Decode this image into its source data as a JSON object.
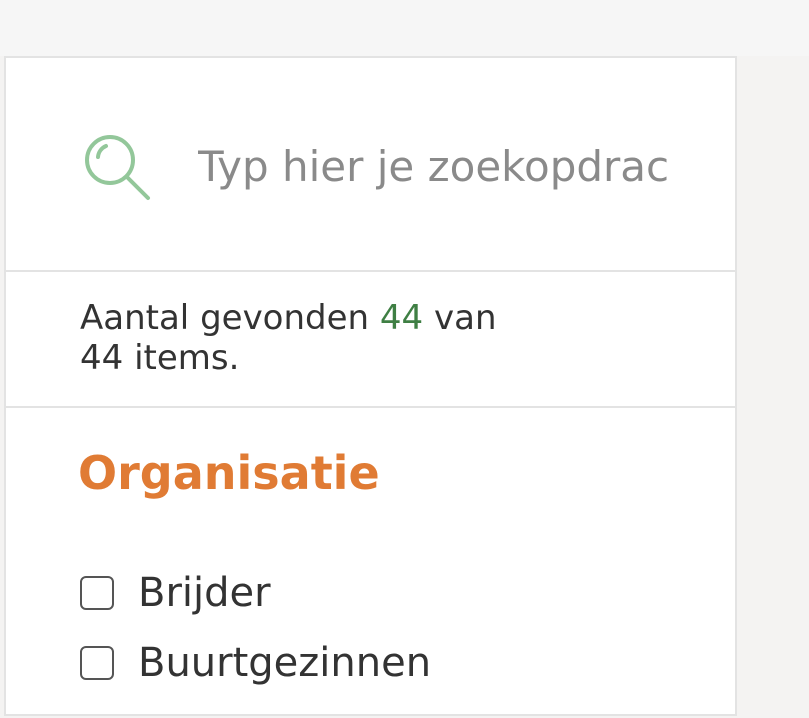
{
  "search": {
    "placeholder": "Typ hier je zoekopdracht",
    "icon": "search-icon",
    "icon_color": "#93c79a"
  },
  "results": {
    "prefix": "Aantal gevonden",
    "found": "44",
    "middle": "van",
    "total": "44",
    "suffix": "items.",
    "highlight_color": "#3f7f44"
  },
  "filter": {
    "heading": "Organisatie",
    "heading_color": "#e07b34",
    "options": [
      {
        "label": "Brijder",
        "checked": false
      },
      {
        "label": "Buurtgezinnen",
        "checked": false
      }
    ]
  }
}
